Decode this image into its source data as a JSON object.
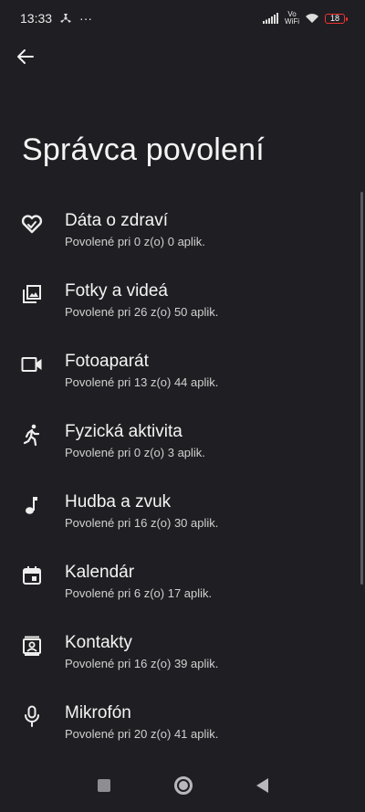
{
  "status_bar": {
    "time": "13:33",
    "dots": "···",
    "vowifi_top": "Vo",
    "vowifi_bottom": "WiFi",
    "battery_level": "18"
  },
  "header": {
    "title": "Správca povolení"
  },
  "permissions": [
    {
      "label": "Dáta o zdraví",
      "sub": "Povolené pri 0 z(o) 0 aplik.",
      "icon": "health-icon"
    },
    {
      "label": "Fotky a videá",
      "sub": "Povolené pri 26 z(o) 50 aplik.",
      "icon": "photos-icon"
    },
    {
      "label": "Fotoaparát",
      "sub": "Povolené pri 13 z(o) 44 aplik.",
      "icon": "camera-icon"
    },
    {
      "label": "Fyzická aktivita",
      "sub": "Povolené pri 0 z(o) 3 aplik.",
      "icon": "running-icon"
    },
    {
      "label": "Hudba a zvuk",
      "sub": "Povolené pri 16 z(o) 30 aplik.",
      "icon": "music-note-icon"
    },
    {
      "label": "Kalendár",
      "sub": "Povolené pri 6 z(o) 17 aplik.",
      "icon": "calendar-icon"
    },
    {
      "label": "Kontakty",
      "sub": "Povolené pri 16 z(o) 39 aplik.",
      "icon": "contacts-icon"
    },
    {
      "label": "Mikrofón",
      "sub": "Povolené pri 20 z(o) 41 aplik.",
      "icon": "microphone-icon"
    }
  ],
  "colors": {
    "background": "#1f1e22",
    "text": "#f4f4f4",
    "battery": "#e33333"
  }
}
